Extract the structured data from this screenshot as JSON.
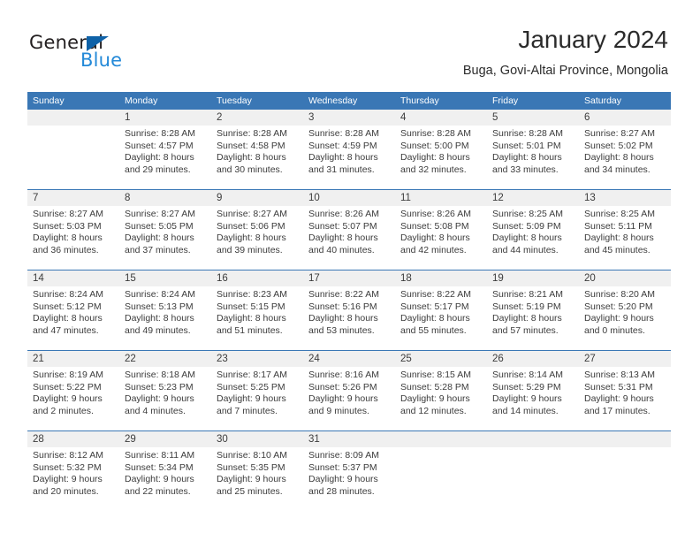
{
  "brand": {
    "name_top": "General",
    "name_bottom": "Blue",
    "accent_color": "#2389d8",
    "triangle_color": "#0f62a8"
  },
  "header": {
    "title": "January 2024",
    "subtitle": "Buga, Govi-Altai Province, Mongolia"
  },
  "calendar": {
    "header_bg": "#3a77b5",
    "numrow_bg": "#f0f0f0",
    "weekdays": [
      "Sunday",
      "Monday",
      "Tuesday",
      "Wednesday",
      "Thursday",
      "Friday",
      "Saturday"
    ],
    "weeks": [
      [
        {
          "day": "",
          "lines": []
        },
        {
          "day": "1",
          "lines": [
            "Sunrise: 8:28 AM",
            "Sunset: 4:57 PM",
            "Daylight: 8 hours",
            "and 29 minutes."
          ]
        },
        {
          "day": "2",
          "lines": [
            "Sunrise: 8:28 AM",
            "Sunset: 4:58 PM",
            "Daylight: 8 hours",
            "and 30 minutes."
          ]
        },
        {
          "day": "3",
          "lines": [
            "Sunrise: 8:28 AM",
            "Sunset: 4:59 PM",
            "Daylight: 8 hours",
            "and 31 minutes."
          ]
        },
        {
          "day": "4",
          "lines": [
            "Sunrise: 8:28 AM",
            "Sunset: 5:00 PM",
            "Daylight: 8 hours",
            "and 32 minutes."
          ]
        },
        {
          "day": "5",
          "lines": [
            "Sunrise: 8:28 AM",
            "Sunset: 5:01 PM",
            "Daylight: 8 hours",
            "and 33 minutes."
          ]
        },
        {
          "day": "6",
          "lines": [
            "Sunrise: 8:27 AM",
            "Sunset: 5:02 PM",
            "Daylight: 8 hours",
            "and 34 minutes."
          ]
        }
      ],
      [
        {
          "day": "7",
          "lines": [
            "Sunrise: 8:27 AM",
            "Sunset: 5:03 PM",
            "Daylight: 8 hours",
            "and 36 minutes."
          ]
        },
        {
          "day": "8",
          "lines": [
            "Sunrise: 8:27 AM",
            "Sunset: 5:05 PM",
            "Daylight: 8 hours",
            "and 37 minutes."
          ]
        },
        {
          "day": "9",
          "lines": [
            "Sunrise: 8:27 AM",
            "Sunset: 5:06 PM",
            "Daylight: 8 hours",
            "and 39 minutes."
          ]
        },
        {
          "day": "10",
          "lines": [
            "Sunrise: 8:26 AM",
            "Sunset: 5:07 PM",
            "Daylight: 8 hours",
            "and 40 minutes."
          ]
        },
        {
          "day": "11",
          "lines": [
            "Sunrise: 8:26 AM",
            "Sunset: 5:08 PM",
            "Daylight: 8 hours",
            "and 42 minutes."
          ]
        },
        {
          "day": "12",
          "lines": [
            "Sunrise: 8:25 AM",
            "Sunset: 5:09 PM",
            "Daylight: 8 hours",
            "and 44 minutes."
          ]
        },
        {
          "day": "13",
          "lines": [
            "Sunrise: 8:25 AM",
            "Sunset: 5:11 PM",
            "Daylight: 8 hours",
            "and 45 minutes."
          ]
        }
      ],
      [
        {
          "day": "14",
          "lines": [
            "Sunrise: 8:24 AM",
            "Sunset: 5:12 PM",
            "Daylight: 8 hours",
            "and 47 minutes."
          ]
        },
        {
          "day": "15",
          "lines": [
            "Sunrise: 8:24 AM",
            "Sunset: 5:13 PM",
            "Daylight: 8 hours",
            "and 49 minutes."
          ]
        },
        {
          "day": "16",
          "lines": [
            "Sunrise: 8:23 AM",
            "Sunset: 5:15 PM",
            "Daylight: 8 hours",
            "and 51 minutes."
          ]
        },
        {
          "day": "17",
          "lines": [
            "Sunrise: 8:22 AM",
            "Sunset: 5:16 PM",
            "Daylight: 8 hours",
            "and 53 minutes."
          ]
        },
        {
          "day": "18",
          "lines": [
            "Sunrise: 8:22 AM",
            "Sunset: 5:17 PM",
            "Daylight: 8 hours",
            "and 55 minutes."
          ]
        },
        {
          "day": "19",
          "lines": [
            "Sunrise: 8:21 AM",
            "Sunset: 5:19 PM",
            "Daylight: 8 hours",
            "and 57 minutes."
          ]
        },
        {
          "day": "20",
          "lines": [
            "Sunrise: 8:20 AM",
            "Sunset: 5:20 PM",
            "Daylight: 9 hours",
            "and 0 minutes."
          ]
        }
      ],
      [
        {
          "day": "21",
          "lines": [
            "Sunrise: 8:19 AM",
            "Sunset: 5:22 PM",
            "Daylight: 9 hours",
            "and 2 minutes."
          ]
        },
        {
          "day": "22",
          "lines": [
            "Sunrise: 8:18 AM",
            "Sunset: 5:23 PM",
            "Daylight: 9 hours",
            "and 4 minutes."
          ]
        },
        {
          "day": "23",
          "lines": [
            "Sunrise: 8:17 AM",
            "Sunset: 5:25 PM",
            "Daylight: 9 hours",
            "and 7 minutes."
          ]
        },
        {
          "day": "24",
          "lines": [
            "Sunrise: 8:16 AM",
            "Sunset: 5:26 PM",
            "Daylight: 9 hours",
            "and 9 minutes."
          ]
        },
        {
          "day": "25",
          "lines": [
            "Sunrise: 8:15 AM",
            "Sunset: 5:28 PM",
            "Daylight: 9 hours",
            "and 12 minutes."
          ]
        },
        {
          "day": "26",
          "lines": [
            "Sunrise: 8:14 AM",
            "Sunset: 5:29 PM",
            "Daylight: 9 hours",
            "and 14 minutes."
          ]
        },
        {
          "day": "27",
          "lines": [
            "Sunrise: 8:13 AM",
            "Sunset: 5:31 PM",
            "Daylight: 9 hours",
            "and 17 minutes."
          ]
        }
      ],
      [
        {
          "day": "28",
          "lines": [
            "Sunrise: 8:12 AM",
            "Sunset: 5:32 PM",
            "Daylight: 9 hours",
            "and 20 minutes."
          ]
        },
        {
          "day": "29",
          "lines": [
            "Sunrise: 8:11 AM",
            "Sunset: 5:34 PM",
            "Daylight: 9 hours",
            "and 22 minutes."
          ]
        },
        {
          "day": "30",
          "lines": [
            "Sunrise: 8:10 AM",
            "Sunset: 5:35 PM",
            "Daylight: 9 hours",
            "and 25 minutes."
          ]
        },
        {
          "day": "31",
          "lines": [
            "Sunrise: 8:09 AM",
            "Sunset: 5:37 PM",
            "Daylight: 9 hours",
            "and 28 minutes."
          ]
        },
        {
          "day": "",
          "lines": []
        },
        {
          "day": "",
          "lines": []
        },
        {
          "day": "",
          "lines": []
        }
      ]
    ]
  }
}
